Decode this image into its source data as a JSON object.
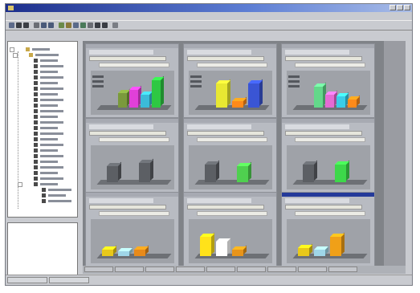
{
  "window": {
    "title": "",
    "menu": [
      "",
      "",
      "",
      "",
      ""
    ],
    "buttons": [
      "minimize-button",
      "maximize-button",
      "close-button"
    ]
  },
  "tree": {
    "rows": 28
  },
  "panels": [
    {
      "id": "p1",
      "bars": [
        {
          "h": 18,
          "c": "#7a9a3c"
        },
        {
          "h": 22,
          "c": "#e040d8"
        },
        {
          "h": 16,
          "c": "#3bbbd8"
        },
        {
          "h": 34,
          "c": "#2ec843"
        }
      ]
    },
    {
      "id": "p2",
      "bars": [
        {
          "h": 30,
          "c": "#e8e832"
        },
        {
          "h": 8,
          "c": "#ff8a1a"
        },
        {
          "h": 30,
          "c": "#3a55d4"
        }
      ]
    },
    {
      "id": "p3",
      "bars": [
        {
          "h": 26,
          "c": "#63d88a"
        },
        {
          "h": 16,
          "c": "#e56bd4"
        },
        {
          "h": 14,
          "c": "#3bcde8"
        },
        {
          "h": 10,
          "c": "#ff8a1a"
        }
      ]
    },
    {
      "id": "p4",
      "bars": [
        {
          "h": 20,
          "c": "#5c5f64"
        },
        {
          "h": 24,
          "c": "#5c5f64"
        }
      ]
    },
    {
      "id": "p5",
      "bars": [
        {
          "h": 22,
          "c": "#5c5f64"
        },
        {
          "h": 20,
          "c": "#4fd04f"
        }
      ]
    },
    {
      "id": "p6",
      "bars": [
        {
          "h": 22,
          "c": "#5c5f64"
        },
        {
          "h": 22,
          "c": "#3dd84a"
        }
      ]
    },
    {
      "id": "p7",
      "bars": [
        {
          "h": 8,
          "c": "#e8c81a"
        },
        {
          "h": 6,
          "c": "#9fd6e8"
        },
        {
          "h": 8,
          "c": "#e88a1a"
        }
      ]
    },
    {
      "id": "p8",
      "bars": [
        {
          "h": 24,
          "c": "#ffe21a"
        },
        {
          "h": 18,
          "c": "#ffffff"
        },
        {
          "h": 8,
          "c": "#e8941a"
        }
      ]
    },
    {
      "id": "p9",
      "bars": [
        {
          "h": 10,
          "c": "#e8c81a"
        },
        {
          "h": 8,
          "c": "#9fd6e8"
        },
        {
          "h": 24,
          "c": "#f0a018"
        }
      ]
    }
  ],
  "colors": {
    "titlebar_start": "#1d2f8c",
    "workspace": "#808388",
    "window_face": "#c9cbd0"
  }
}
